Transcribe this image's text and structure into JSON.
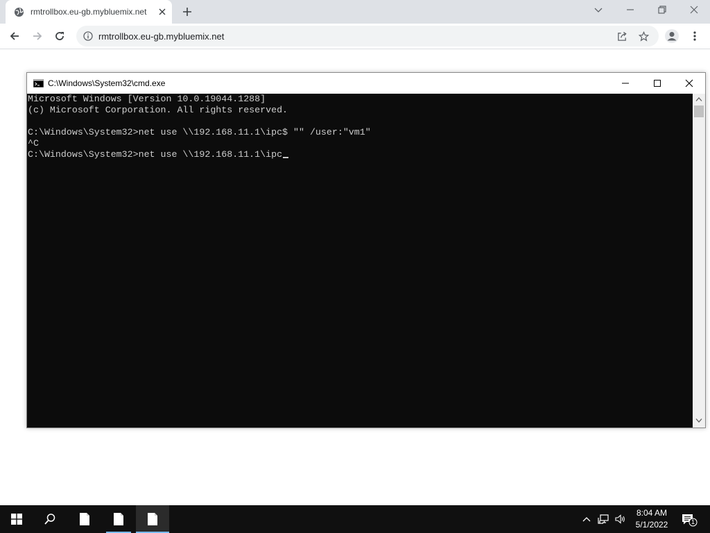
{
  "browser": {
    "tab_title": "rmtrollbox.eu-gb.mybluemix.net",
    "url": "rmtrollbox.eu-gb.mybluemix.net"
  },
  "cmd": {
    "title": "C:\\Windows\\System32\\cmd.exe",
    "lines": [
      "Microsoft Windows [Version 10.0.19044.1288]",
      "(c) Microsoft Corporation. All rights reserved.",
      "",
      "C:\\Windows\\System32>net use \\\\192.168.11.1\\ipc$ \"\" /user:\"vm1\"",
      "^C",
      "C:\\Windows\\System32>net use \\\\192.168.11.1\\ipc"
    ]
  },
  "taskbar": {
    "time": "8:04 AM",
    "date": "5/1/2022",
    "notification_count": "1"
  },
  "colors": {
    "console_bg": "#0c0c0c",
    "console_fg": "#cccccc",
    "taskbar_bg": "#101010",
    "tab_strip": "#dee1e6",
    "accent": "#76b9ed"
  }
}
